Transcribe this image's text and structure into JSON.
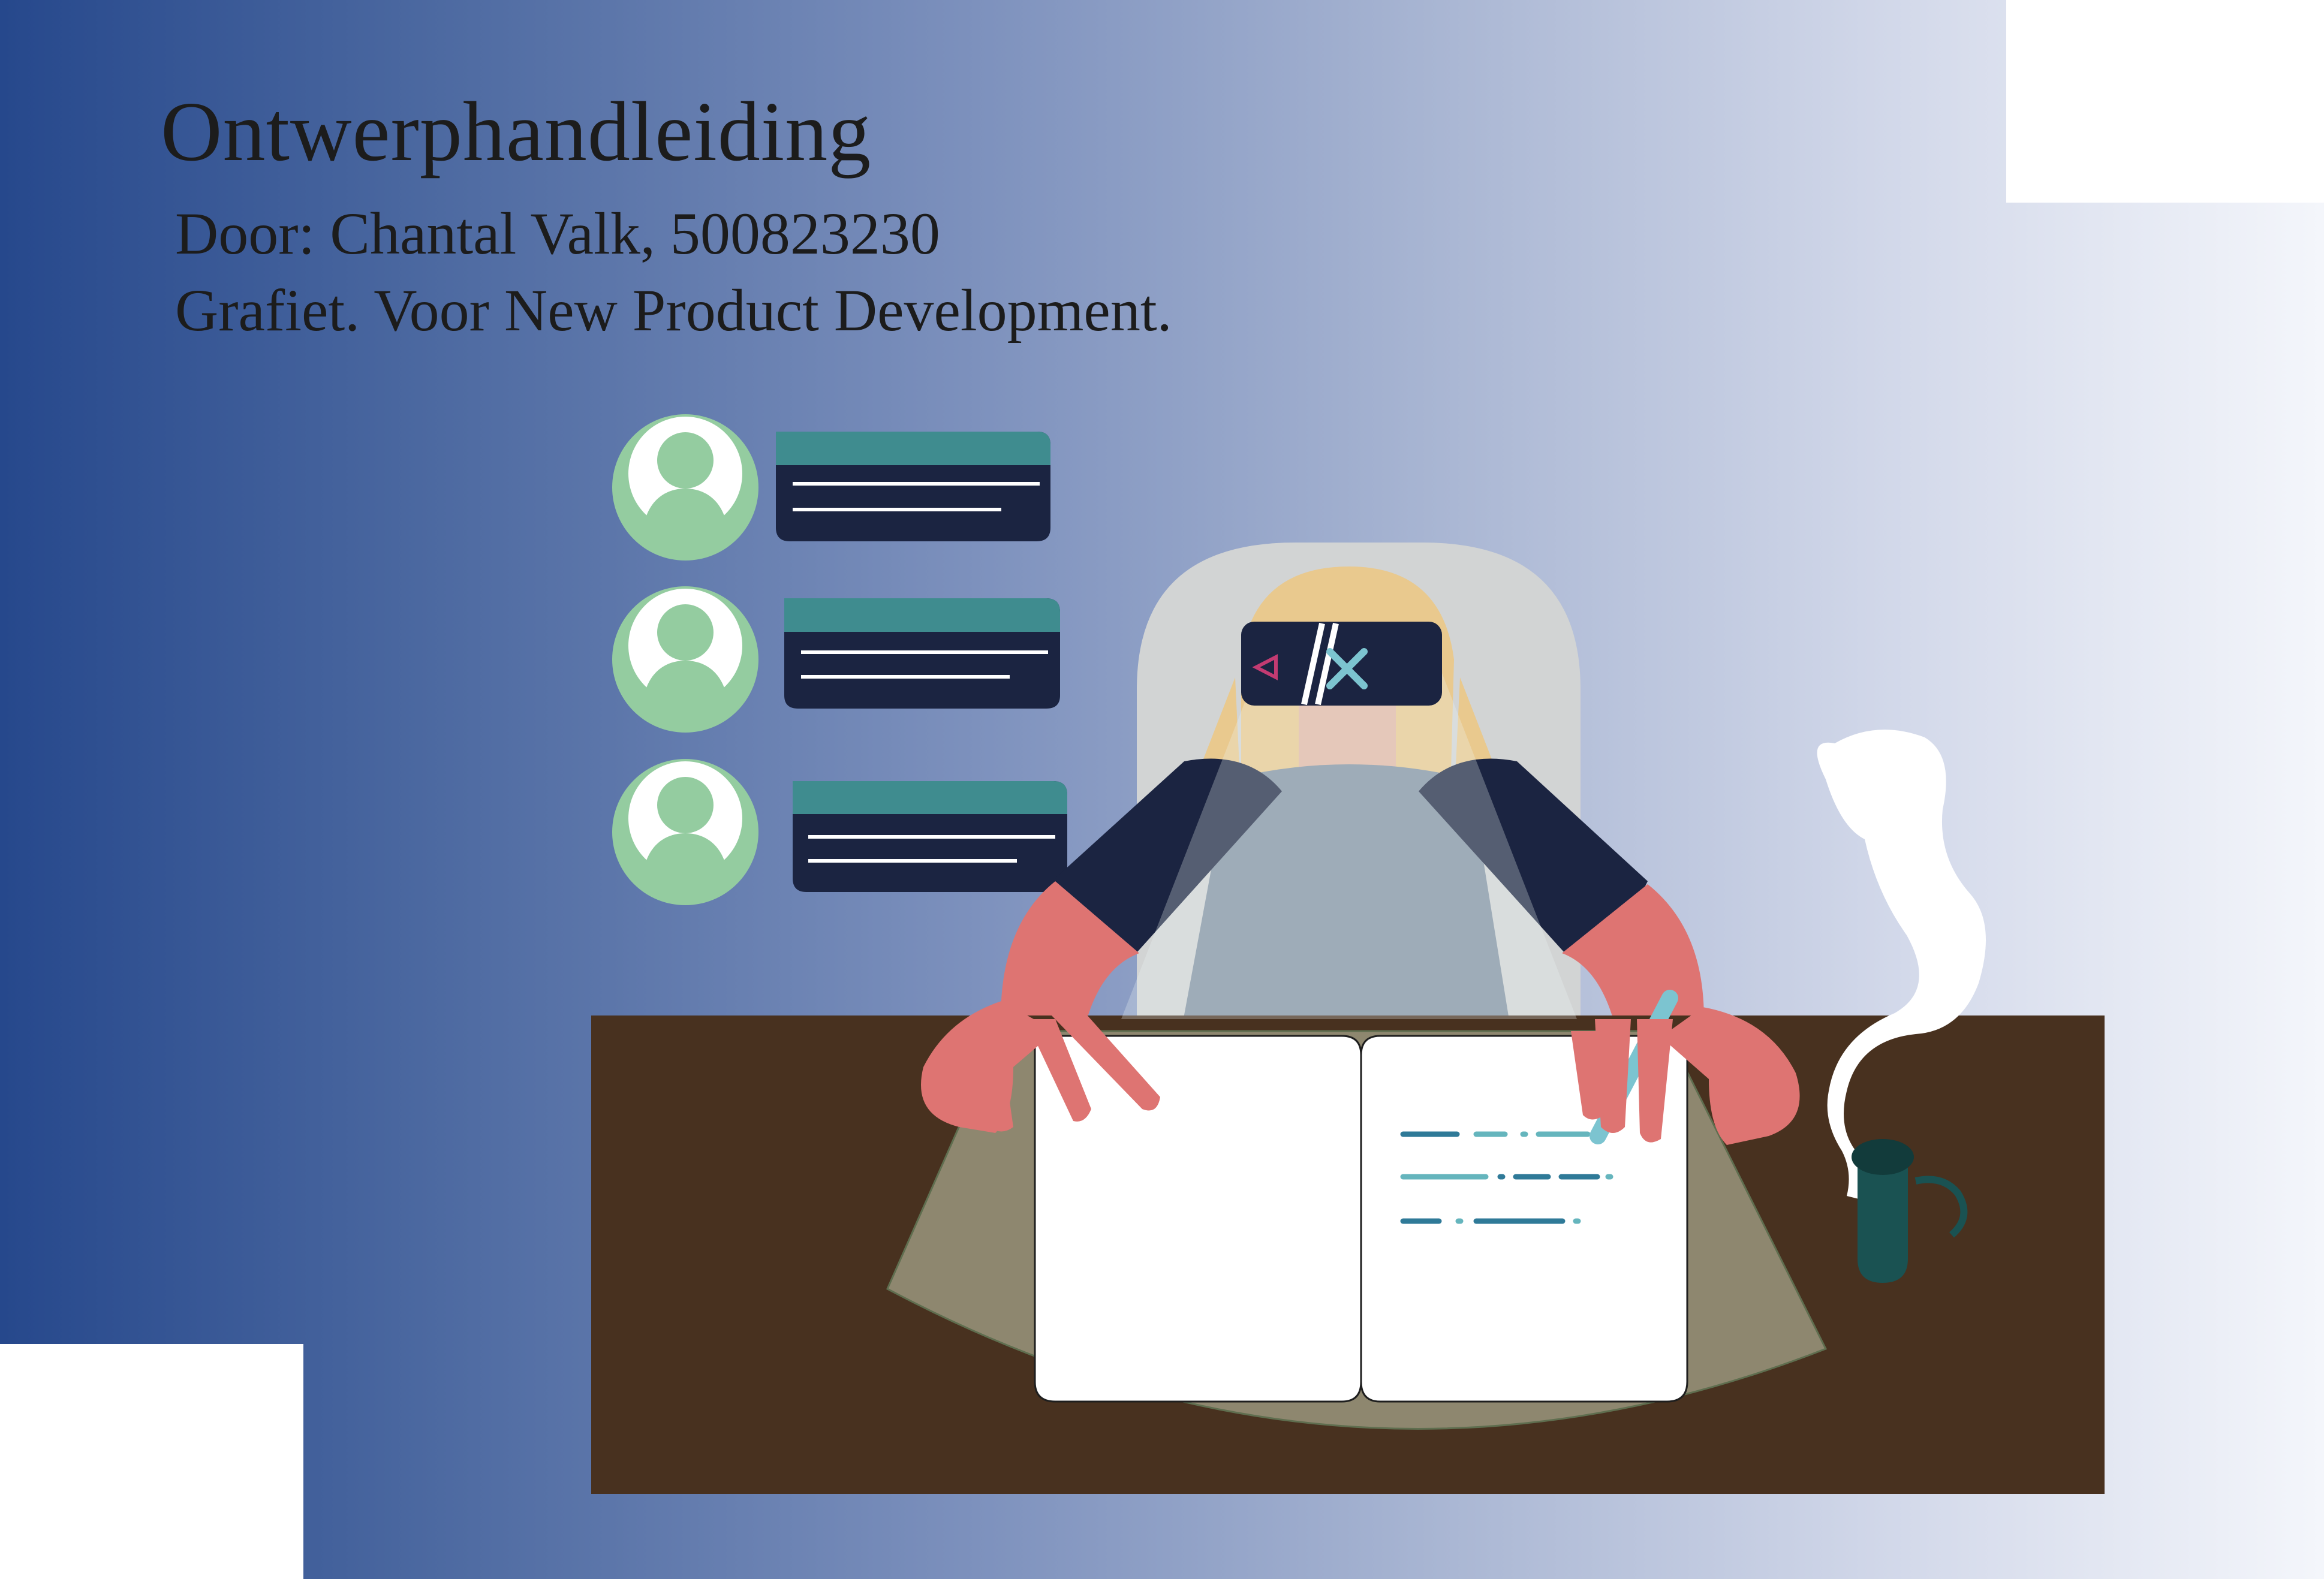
{
  "header": {
    "title": "Ontwerphandleiding",
    "author_line": "Door: Chantal Valk, 500823230",
    "org_line": "Grafiet. Voor New Product Development."
  },
  "chat_panel": {
    "messages": [
      {
        "avatar_icon": "user-avatar-icon"
      },
      {
        "avatar_icon": "user-avatar-icon"
      },
      {
        "avatar_icon": "user-avatar-icon"
      }
    ]
  },
  "illustration": {
    "subject": "person-with-vr-headset",
    "icons": [
      "vr-headset-icon",
      "play-icon",
      "close-icon",
      "pen-icon",
      "coffee-mug-icon",
      "steam-icon"
    ]
  },
  "colors": {
    "gradient_start": "#26488c",
    "gradient_end": "#f4f6fb",
    "avatar_green": "#94cca0",
    "bubble_header": "#3f8c8f",
    "bubble_body": "#1b2441",
    "desk": "#48311f",
    "skin": "#de7472",
    "shirt": "#8090a1",
    "hair": "#e9c98e",
    "mug": "#1a5252"
  }
}
